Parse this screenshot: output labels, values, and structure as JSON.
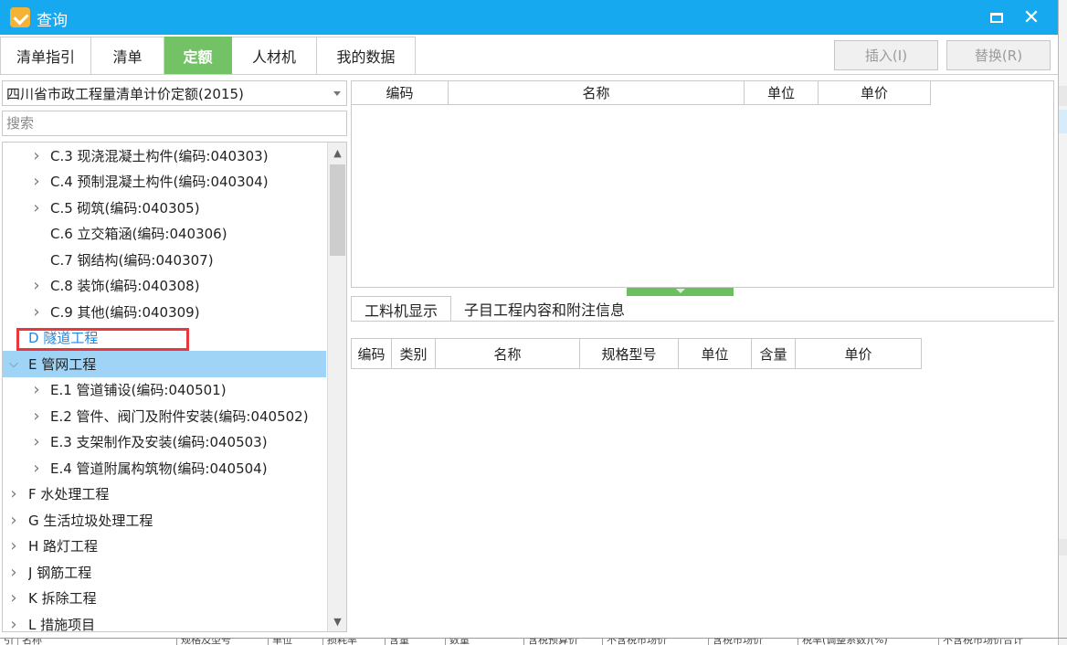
{
  "window": {
    "title": "查询",
    "icon": "app-check-icon",
    "accent": "#16a9ef"
  },
  "tabs": [
    {
      "label": "清单指引",
      "active": false
    },
    {
      "label": "清单",
      "active": false
    },
    {
      "label": "定额",
      "active": true
    },
    {
      "label": "人材机",
      "active": false
    },
    {
      "label": "我的数据",
      "active": false
    }
  ],
  "actions": {
    "insert_label": "插入(I)",
    "replace_label": "替换(R)"
  },
  "left": {
    "library": "四川省市政工程量清单计价定额(2015)",
    "search_placeholder": "搜索",
    "tree": [
      {
        "label": "C.3 现浇混凝土构件(编码:040303)",
        "level": 2,
        "expandable": true
      },
      {
        "label": "C.4 预制混凝土构件(编码:040304)",
        "level": 2,
        "expandable": true
      },
      {
        "label": "C.5 砌筑(编码:040305)",
        "level": 2,
        "expandable": true
      },
      {
        "label": "C.6 立交箱涵(编码:040306)",
        "level": 2,
        "expandable": false
      },
      {
        "label": "C.7 钢结构(编码:040307)",
        "level": 2,
        "expandable": false
      },
      {
        "label": "C.8 装饰(编码:040308)",
        "level": 2,
        "expandable": true
      },
      {
        "label": "C.9 其他(编码:040309)",
        "level": 2,
        "expandable": true
      },
      {
        "label": "D 隧道工程",
        "level": 1,
        "expandable": false,
        "link": true
      },
      {
        "label": "E 管网工程",
        "level": 1,
        "expandable": true,
        "expanded": true,
        "selected": true
      },
      {
        "label": "E.1 管道铺设(编码:040501)",
        "level": 2,
        "expandable": true
      },
      {
        "label": "E.2 管件、阀门及附件安装(编码:040502)",
        "level": 2,
        "expandable": true
      },
      {
        "label": "E.3 支架制作及安装(编码:040503)",
        "level": 2,
        "expandable": true
      },
      {
        "label": "E.4 管道附属构筑物(编码:040504)",
        "level": 2,
        "expandable": true
      },
      {
        "label": "F 水处理工程",
        "level": 1,
        "expandable": true
      },
      {
        "label": "G 生活垃圾处理工程",
        "level": 1,
        "expandable": true
      },
      {
        "label": "H 路灯工程",
        "level": 1,
        "expandable": true
      },
      {
        "label": "J 钢筋工程",
        "level": 1,
        "expandable": true
      },
      {
        "label": "K 拆除工程",
        "level": 1,
        "expandable": true
      },
      {
        "label": "L 措施项目",
        "level": 1,
        "expandable": true
      }
    ]
  },
  "top_grid": {
    "columns": [
      "编码",
      "名称",
      "单位",
      "单价"
    ]
  },
  "sub_tabs": [
    {
      "label": "工料机显示",
      "active": true
    },
    {
      "label": "子目工程内容和附注信息",
      "active": false
    }
  ],
  "bottom_grid": {
    "columns": [
      "编码",
      "类别",
      "名称",
      "规格型号",
      "单位",
      "含量",
      "单价"
    ]
  },
  "bg_footer": {
    "columns": [
      "引",
      "名称",
      "规格及型号",
      "单位",
      "损耗率",
      "含量",
      "数量",
      "含税预算价",
      "不含税市场价",
      "含税市场价",
      "税率(调整系数)(%)",
      "不含税市场价合计"
    ]
  }
}
